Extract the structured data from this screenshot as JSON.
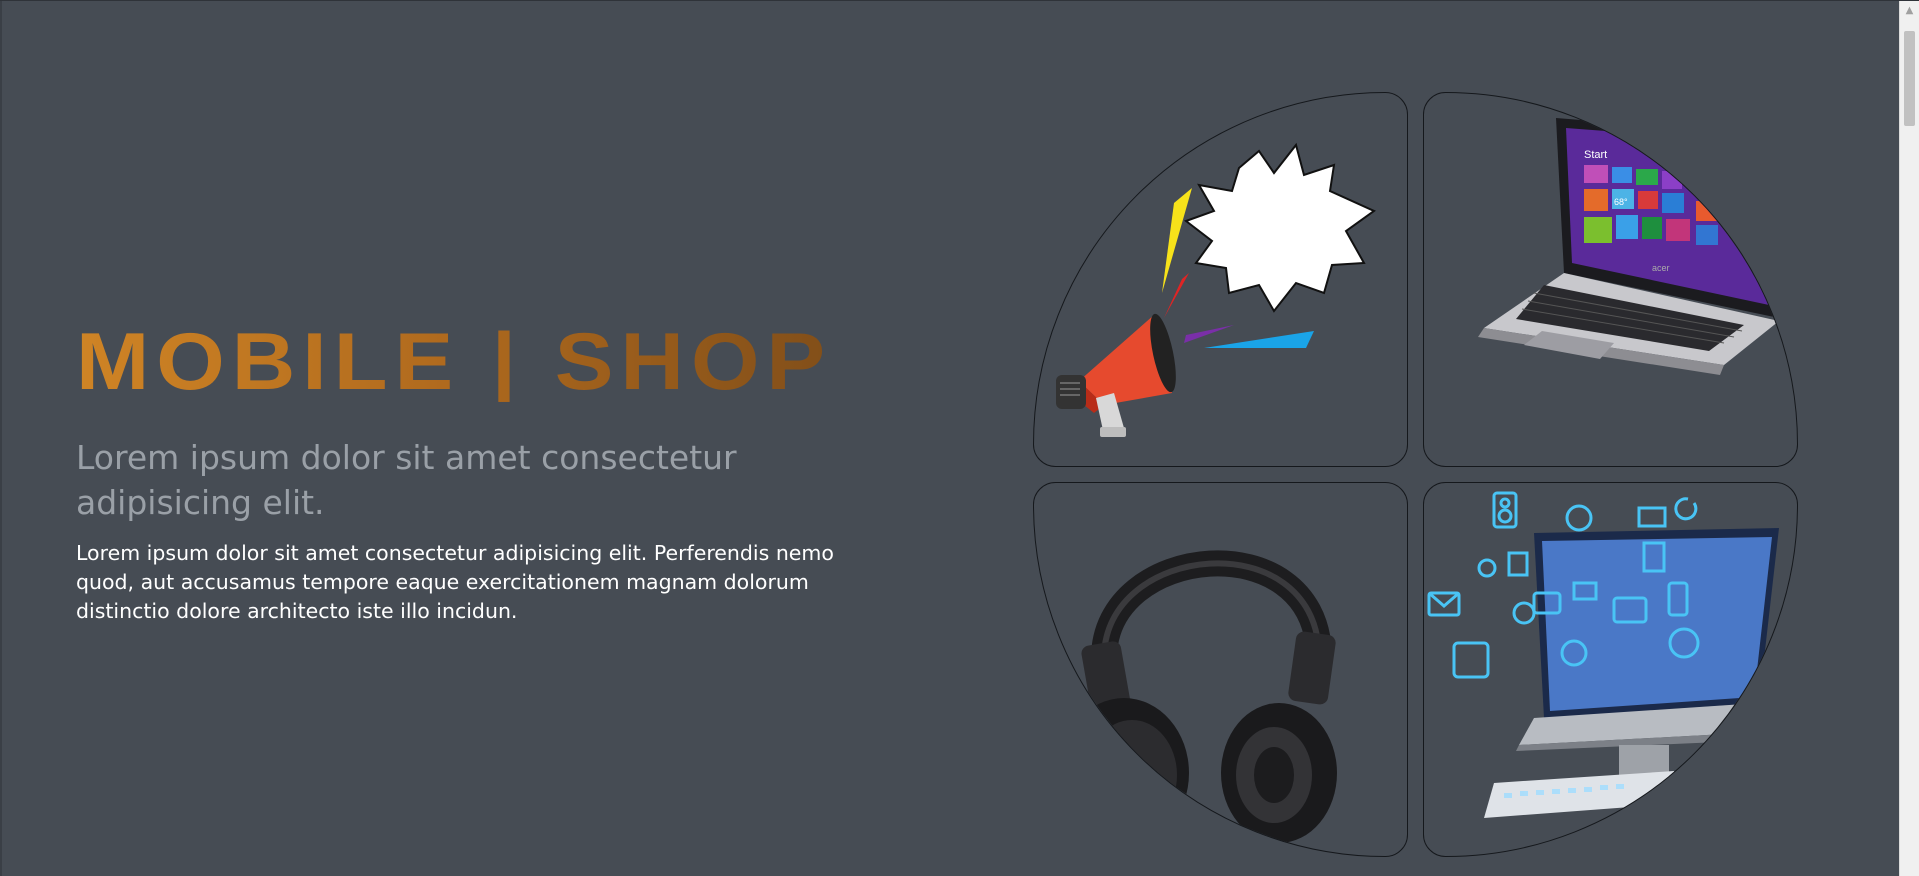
{
  "hero": {
    "brand": "MOBILE | SHOP",
    "subtitle": "Lorem ipsum dolor sit amet consectetur adipisicing elit.",
    "body": "Lorem ipsum dolor sit amet consectetur adipisicing elit. Perferendis nemo quod, aut accusamus tempore eaque exercitationem magnam dolorum distinctio dolore architecto iste illo incidun."
  },
  "gallery": {
    "images": [
      {
        "name": "megaphone-image",
        "icon": "megaphone-icon"
      },
      {
        "name": "laptop-image",
        "icon": "laptop-icon"
      },
      {
        "name": "headphones-image",
        "icon": "headphones-icon"
      },
      {
        "name": "desktop-computer-image",
        "icon": "monitor-icon"
      }
    ]
  },
  "laptop_screen": {
    "start_label": "Start",
    "brand_logo": "acer",
    "tile_temp": "68°"
  },
  "colors": {
    "background": "#464c54",
    "brand_gradient_start": "#cf8425",
    "brand_gradient_end": "#7a4a18",
    "subtitle": "#9aa0a7",
    "body": "#ffffff"
  }
}
